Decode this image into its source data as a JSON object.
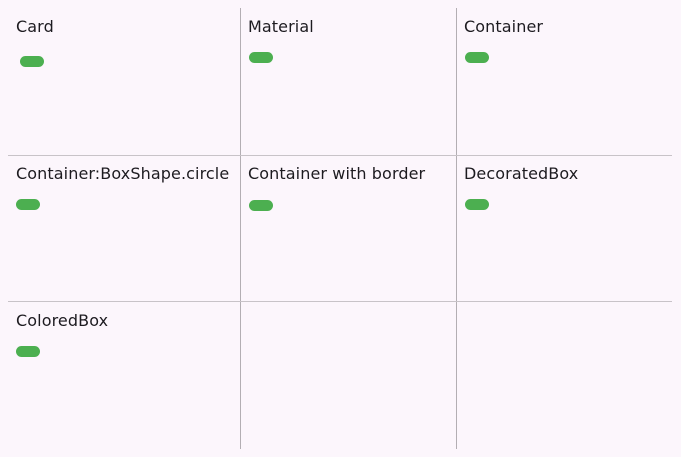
{
  "grid": {
    "cells": [
      {
        "title": "Card"
      },
      {
        "title": "Material"
      },
      {
        "title": "Container"
      },
      {
        "title": "Container:BoxShape.circle"
      },
      {
        "title": "Container with border"
      },
      {
        "title": "DecoratedBox"
      },
      {
        "title": "ColoredBox"
      },
      {
        "title": ""
      },
      {
        "title": ""
      }
    ]
  },
  "colors": {
    "background": "#fcf6fc",
    "indicator": "#4caf50",
    "divider": "#b3aeb3",
    "text": "#1d1b20"
  }
}
